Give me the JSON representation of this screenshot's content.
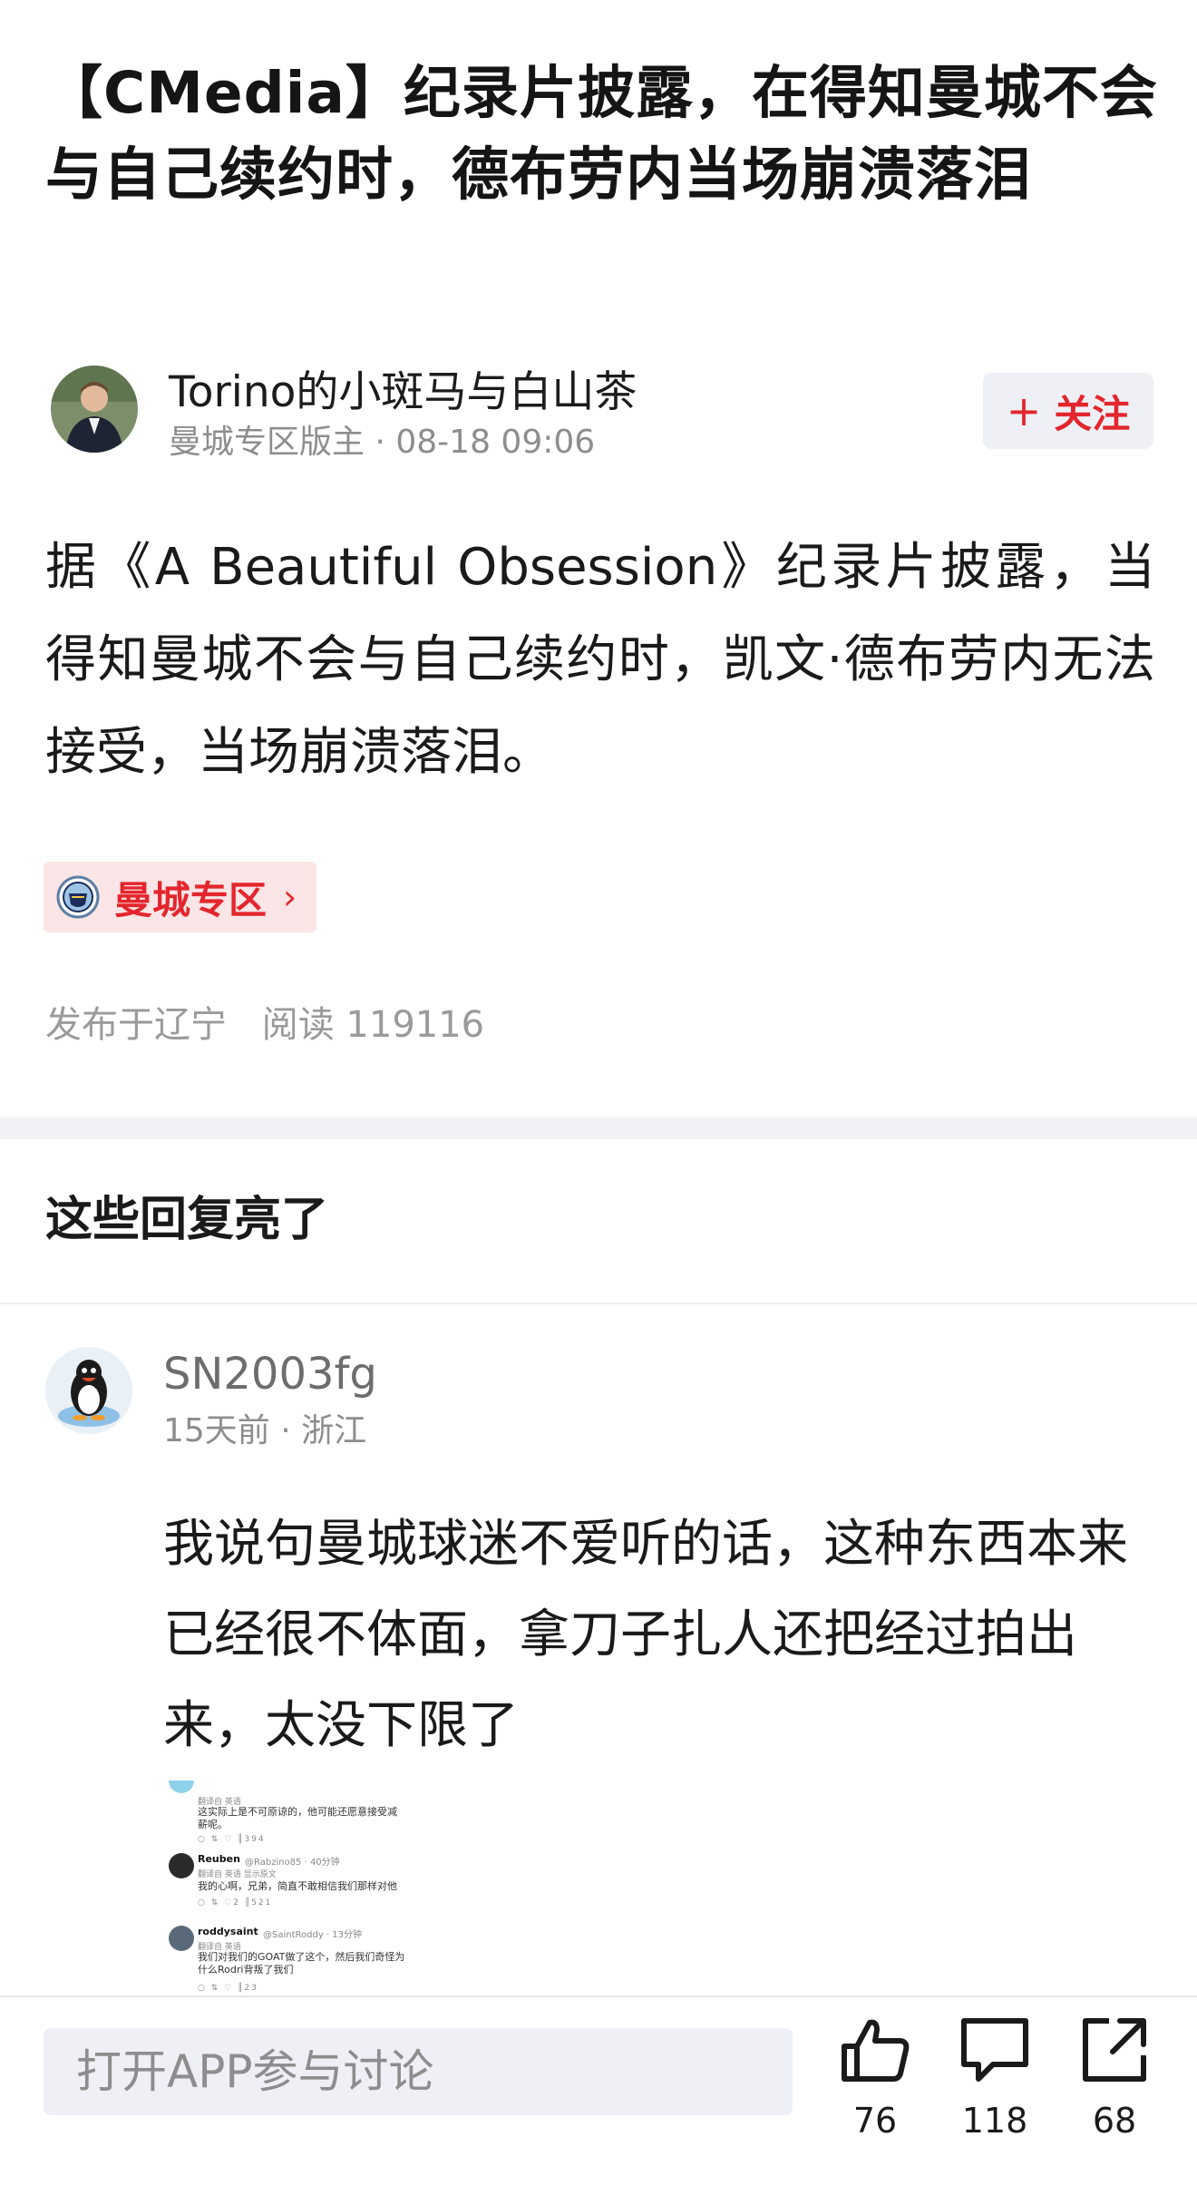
{
  "post": {
    "title": "【CMedia】纪录片披露，在得知曼城不会与自己续约时，德布劳内当场崩溃落泪",
    "author": {
      "name": "Torino的小斑马与白山茶",
      "role": "曼城专区版主",
      "datetime": "08-18 09:06"
    },
    "follow_label": "关注",
    "body": "据《A Beautiful Obsession》纪录片披露，当得知曼城不会与自己续约时，凯文·德布劳内无法接受，当场崩溃落泪。",
    "topic_tag": "曼城专区",
    "published_from": "发布于辽宁",
    "reads": "阅读 119116"
  },
  "replies_section": {
    "title": "这些回复亮了",
    "items": [
      {
        "username": "SN2003fg",
        "time": "15天前",
        "location": "浙江",
        "text": "我说句曼城球迷不爱听的话，这种东西本来已经很不体面，拿刀子扎人还把经过拍出来，太没下限了",
        "image": {
          "entries": [
            {
              "trans": "翻译自 英语",
              "text": "这实际上是不可原谅的，他可能还愿意接受减薪呢。",
              "stats": "394"
            },
            {
              "name": "Reuben",
              "handle": "@Rabzino85 · 40分钟",
              "trans": "翻译自 英语 显示原文",
              "text": "我的心啊，兄弟，简直不敢相信我们那样对他",
              "stats": "521",
              "likes": "2"
            },
            {
              "name": "roddysaint",
              "handle": "@SaintRoddy · 13分钟",
              "trans": "翻译自 英语",
              "text": "我们对我们的GOAT做了这个，然后我们奇怪为什么Rodri背叛了我们",
              "stats": "23"
            }
          ]
        }
      }
    ]
  },
  "bottom_bar": {
    "input_placeholder": "打开APP参与讨论",
    "likes": "76",
    "comments": "118",
    "shares": "68"
  },
  "colors": {
    "accent_red": "#e3262d",
    "muted_gray": "#8d8d8d",
    "input_bg": "#eef0f5",
    "tag_bg": "#fbe5e6"
  }
}
